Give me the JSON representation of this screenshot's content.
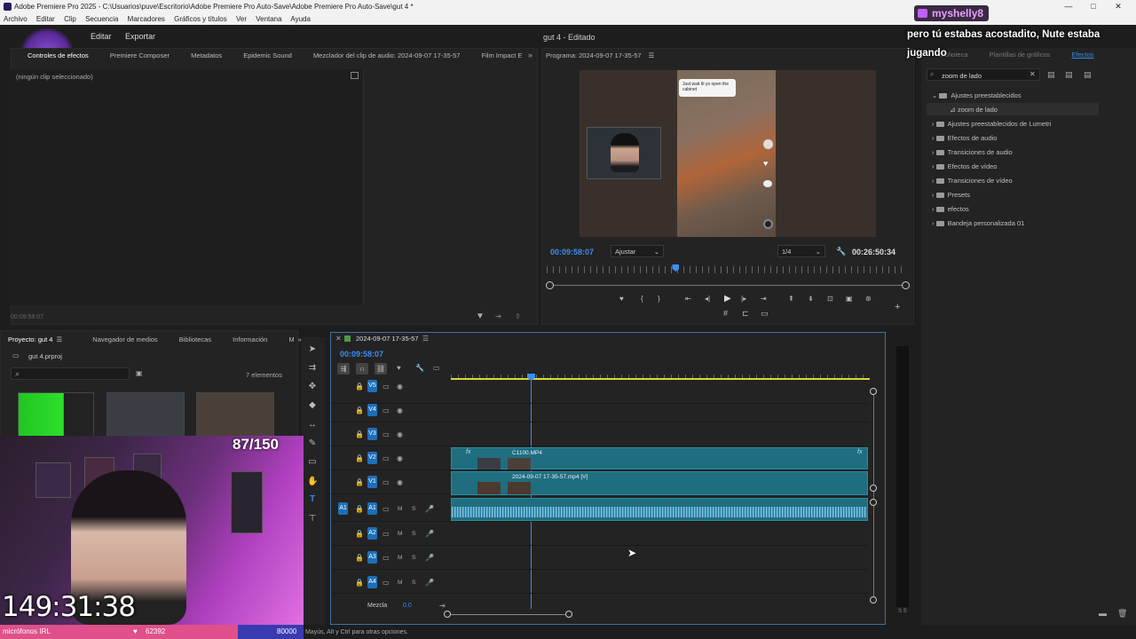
{
  "window": {
    "title": "Adobe Premiere Pro 2025 - C:\\Usuarios\\puve\\Escritorio\\Adobe Premiere Pro Auto-Save\\Adobe Premiere Pro Auto-Save\\gut 4 *",
    "minimize": "—",
    "maximize": "□",
    "close": "✕"
  },
  "menu": [
    "Archivo",
    "Editar",
    "Clip",
    "Secuencia",
    "Marcadores",
    "Gráficos y títulos",
    "Ver",
    "Ventana",
    "Ayuda"
  ],
  "header": {
    "editar": "Editar",
    "exportar": "Exportar",
    "doc_title": "gut 4 - Editado"
  },
  "source_panel": {
    "tabs": [
      "Controles de efectos",
      "Premiere Composer",
      "Metadatos",
      "Epidemic Sound",
      "Mezclador del clip de audio: 2024-09-07 17-35-57",
      "Film Impact E"
    ],
    "empty": "(ningún clip seleccionado)",
    "timecode": "00:09:58:07"
  },
  "program": {
    "tab": "Programa: 2024-09-07 17-35-57",
    "timecode_left": "00:09:58:07",
    "fit": "Ajustar",
    "resolution": "1/4",
    "timecode_right": "00:26:50:34",
    "tiktok_caption": "Just wait til yo open the cabinet",
    "playhead_fraction": 0.36
  },
  "effects": {
    "tabs": [
      "Biblioteca",
      "Plantillas de gráficos",
      "Efectos"
    ],
    "search_value": "zoom de lado",
    "items": [
      {
        "label": "Ajustes preestablecidos",
        "open": true
      },
      {
        "label": "zoom de lado",
        "child": true
      },
      {
        "label": "Ajustes preestablecidos de Lumetri"
      },
      {
        "label": "Efectos de audio"
      },
      {
        "label": "Transiciones de audio"
      },
      {
        "label": "Efectos de vídeo"
      },
      {
        "label": "Transiciones de vídeo"
      },
      {
        "label": "Presets"
      },
      {
        "label": "efectos"
      },
      {
        "label": "Bandeja personalizada 01"
      }
    ]
  },
  "project": {
    "tabs": [
      "Proyecto: gut 4",
      "Navegador de medios",
      "Bibliotecas",
      "Información",
      "M"
    ],
    "file": "gut 4.prproj",
    "count": "7 elementos"
  },
  "timeline": {
    "tab": "2024-09-07 17-35-57",
    "timecode": "00:09:58:07",
    "video_tracks": [
      "V5",
      "V4",
      "V3",
      "V2",
      "V1"
    ],
    "audio_tracks": [
      "A1",
      "A2",
      "A3",
      "A4"
    ],
    "source_patch": "A1",
    "mix_label": "Mezcla",
    "mix_value": "0.0",
    "clip_v2": "C1100.MP4",
    "clip_v1": "2024-09-07 17-35-57.mp4 [V]",
    "track_m": "M",
    "track_s": "S"
  },
  "status": {
    "text": "Mayús, Alt y Ctrl para otras opciones."
  },
  "overlay": {
    "counter": "87/150",
    "stream_time": "149:31:38",
    "bar_left": "micrófonos IRL",
    "bar_mid": "62392",
    "bar_right": "80000",
    "chat_user": "myshelly8",
    "chat_message": "pero tú estabas acostadito, Nute estaba jugando"
  },
  "colors": {
    "accent": "#2d8ceb",
    "clip": "#1f6e80",
    "playhead": "#5aa0ff"
  }
}
